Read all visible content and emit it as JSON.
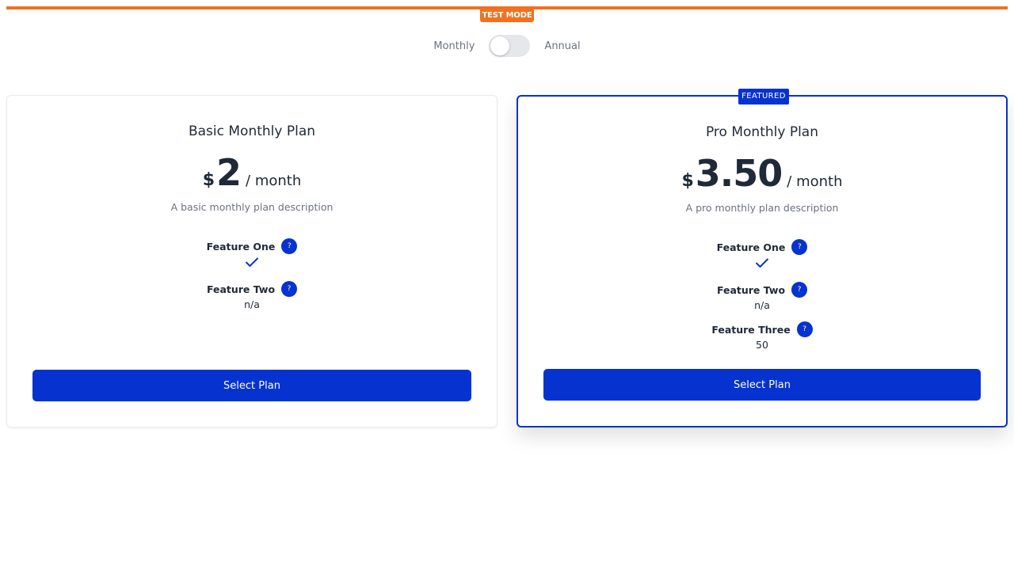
{
  "colors": {
    "test_mode": "#f37021",
    "primary": "#0633d0",
    "muted_text": "#6b7280",
    "toggle_track": "#e5e7eb"
  },
  "test_mode": {
    "label": "TEST MODE"
  },
  "billing_toggle": {
    "monthly_label": "Monthly",
    "annual_label": "Annual",
    "selected": "Monthly"
  },
  "plans": [
    {
      "name": "Basic Monthly Plan",
      "currency": "$",
      "amount": "2",
      "period": "/ month",
      "description": "A basic monthly plan description",
      "features": [
        {
          "name": "Feature One",
          "help_icon": "?",
          "value_icon": "check-icon"
        },
        {
          "name": "Feature Two",
          "help_icon": "?",
          "value": "n/a"
        }
      ],
      "button_label": "Select Plan"
    },
    {
      "badge": "FEATURED",
      "name": "Pro Monthly Plan",
      "currency": "$",
      "amount": "3.50",
      "period": "/ month",
      "description": "A pro monthly plan description",
      "features": [
        {
          "name": "Feature One",
          "help_icon": "?",
          "value_icon": "check-icon"
        },
        {
          "name": "Feature Two",
          "help_icon": "?",
          "value": "n/a"
        },
        {
          "name": "Feature Three",
          "help_icon": "?",
          "value": "50"
        }
      ],
      "button_label": "Select Plan"
    }
  ]
}
